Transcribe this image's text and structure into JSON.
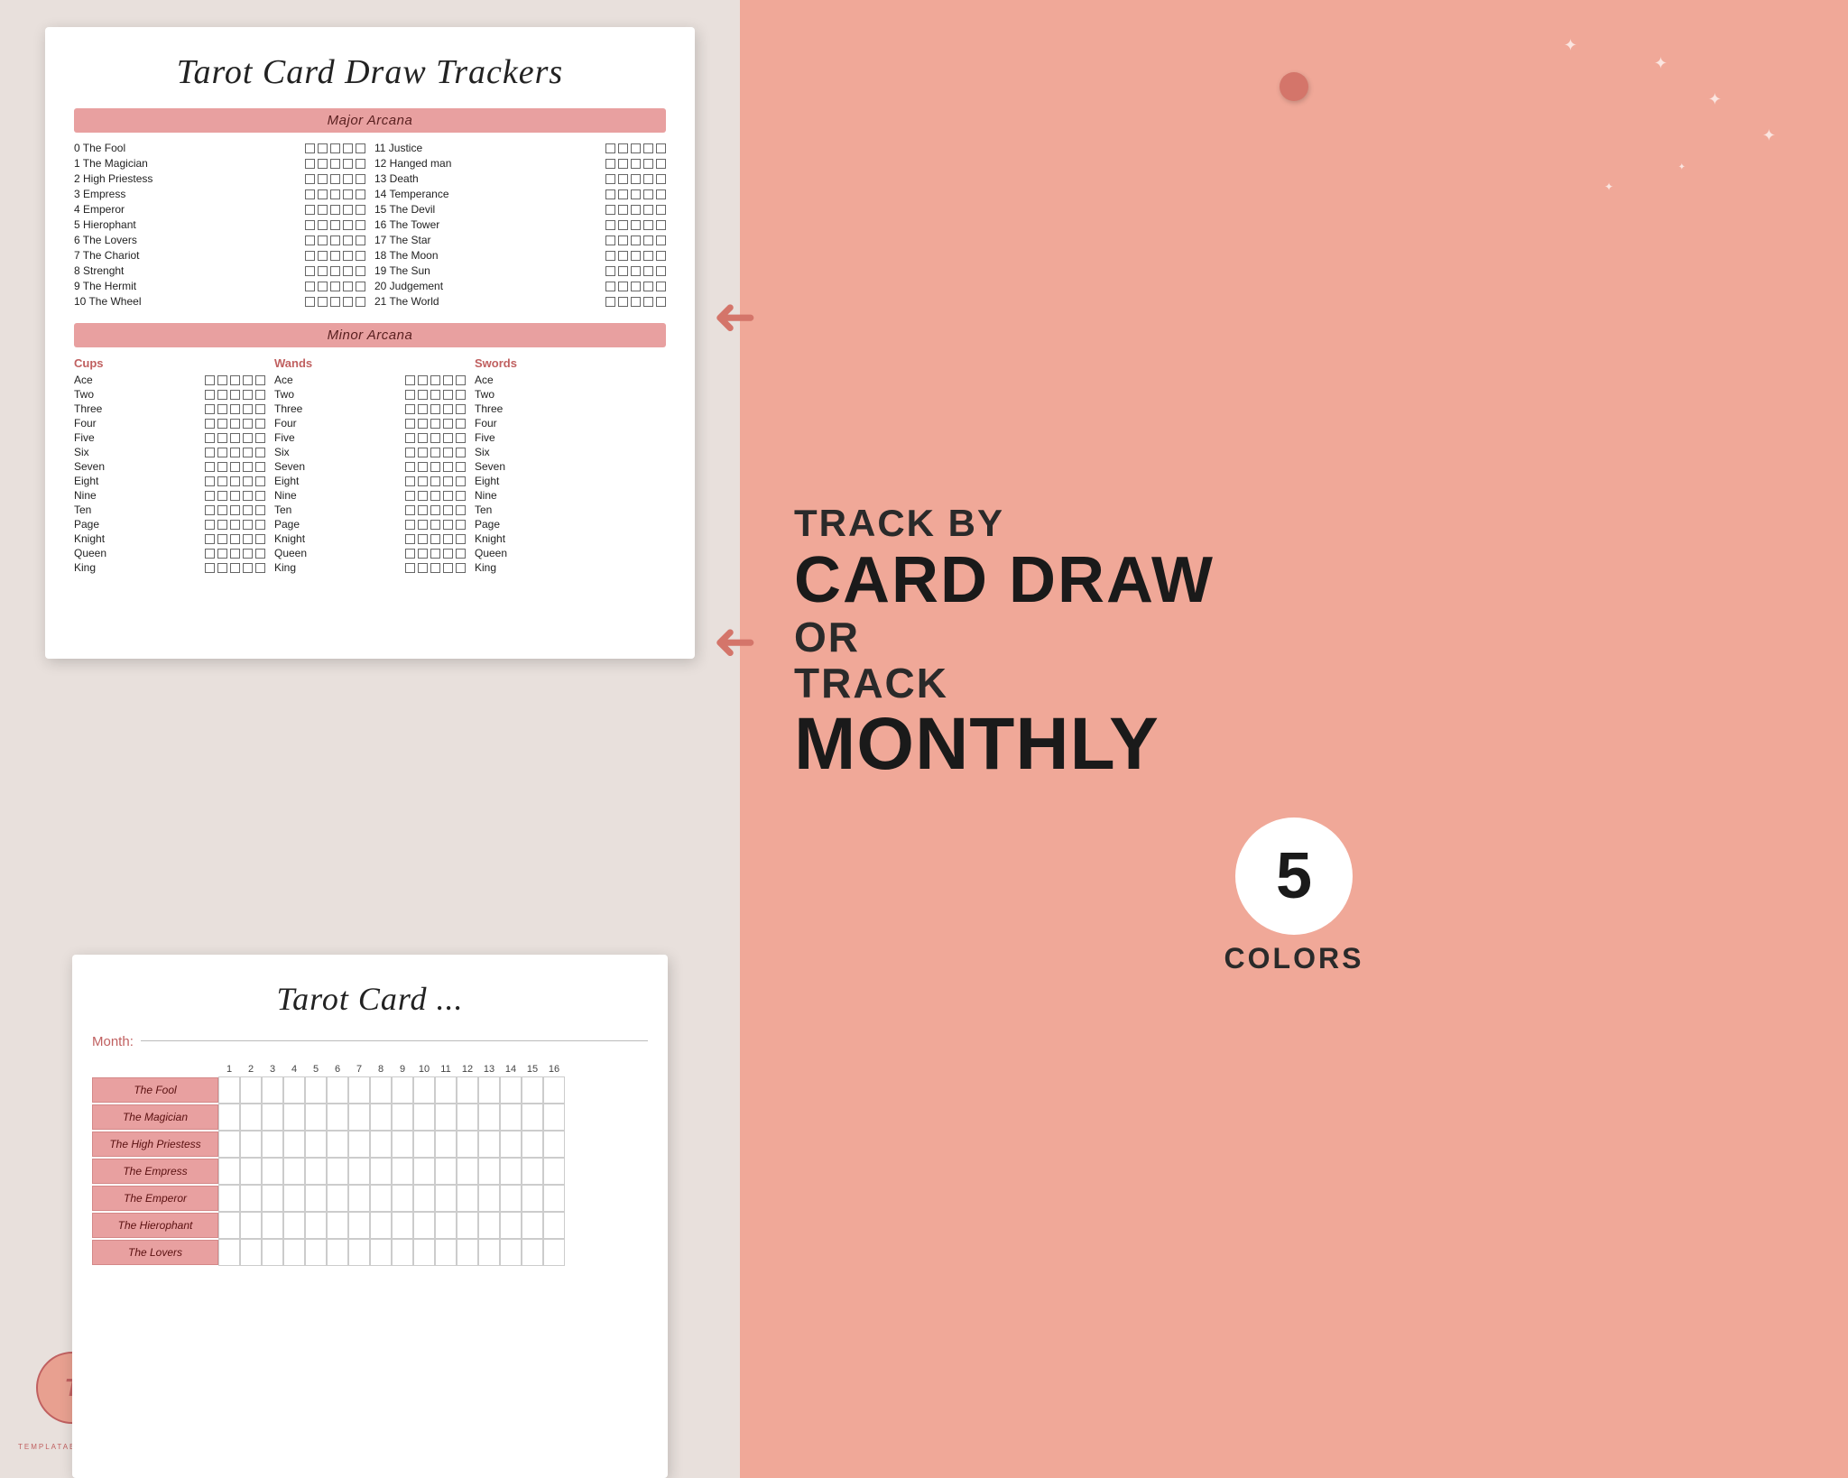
{
  "doc1": {
    "title": "Tarot Card Draw Trackers",
    "major_arcana_header": "Major Arcana",
    "minor_arcana_header": "Minor Arcana",
    "major_col1": [
      "0 The Fool",
      "1 The Magician",
      "2 High Priestess",
      "3 Empress",
      "4 Emperor",
      "5 Hierophant",
      "6 The Lovers",
      "7 The Chariot",
      "8 Strenght",
      "9 The Hermit",
      "10 The Wheel"
    ],
    "major_col2": [
      "11 Justice",
      "12 Hanged man",
      "13 Death",
      "14 Temperance",
      "15 The Devil",
      "16 The Tower",
      "17 The Star",
      "18 The Moon",
      "19 The Sun",
      "20 Judgement",
      "21 The World"
    ],
    "cups_title": "Cups",
    "cups_items": [
      "Ace",
      "Two",
      "Three",
      "Four",
      "Five",
      "Six",
      "Seven",
      "Eight",
      "Nine",
      "Ten",
      "Page",
      "Knight",
      "Queen",
      "King"
    ],
    "wands_title": "Wands",
    "wands_items": [
      "Ace",
      "Two",
      "Three",
      "Four",
      "Five",
      "Six",
      "Seven",
      "Eight",
      "Nine",
      "Ten",
      "Page",
      "Knight",
      "Queen",
      "King"
    ],
    "swords_title": "Swords",
    "swords_items": [
      "Ace",
      "Two",
      "Three",
      "Four",
      "Five",
      "Six",
      "Seven",
      "Eight",
      "Nine",
      "Ten",
      "Page",
      "Knight",
      "Queen",
      "King"
    ]
  },
  "doc2": {
    "title": "Tarot Card",
    "month_label": "Month:",
    "grid_numbers": [
      "1",
      "2",
      "3",
      "4",
      "5",
      "6",
      "7",
      "8",
      "9",
      "10",
      "11",
      "12",
      "13",
      "14",
      "15",
      "16"
    ],
    "grid_rows": [
      "The Fool",
      "The Magician",
      "The High Priestess",
      "The Empress",
      "The Emperor",
      "The Hierophant",
      "The Lovers"
    ]
  },
  "right": {
    "track_by": "TRACK BY",
    "card_draw": "CARD DRAW",
    "or": "OR",
    "track": "TRACK",
    "monthly": "MONTHLY",
    "colors_number": "5",
    "colors_label": "COLORS"
  },
  "logo": {
    "initial": "T",
    "brand": "TEMPLATABLES"
  }
}
